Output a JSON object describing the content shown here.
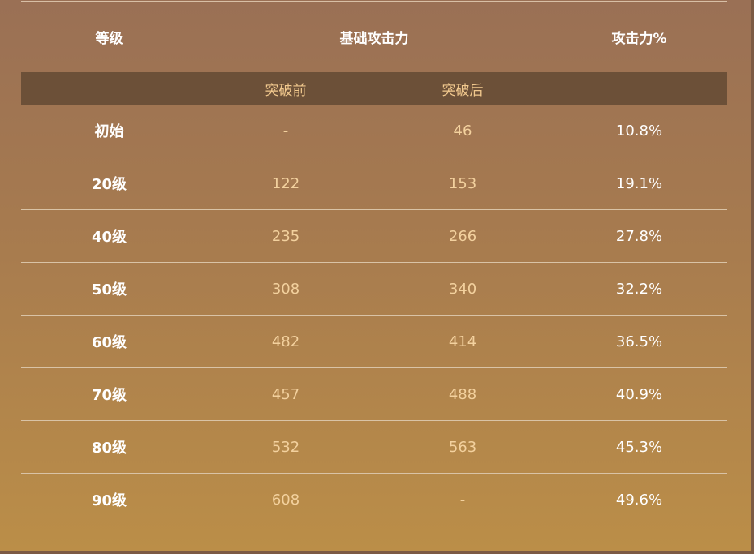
{
  "header": {
    "level": "等级",
    "base_attack": "基础攻击力",
    "attack_pct": "攻击力%"
  },
  "subheader": {
    "before": "突破前",
    "after": "突破后"
  },
  "rows": [
    {
      "level": "初始",
      "before": "-",
      "after": "46",
      "pct": "10.8%"
    },
    {
      "level": "20级",
      "before": "122",
      "after": "153",
      "pct": "19.1%"
    },
    {
      "level": "40级",
      "before": "235",
      "after": "266",
      "pct": "27.8%"
    },
    {
      "level": "50级",
      "before": "308",
      "after": "340",
      "pct": "32.2%"
    },
    {
      "level": "60级",
      "before": "482",
      "after": "414",
      "pct": "36.5%"
    },
    {
      "level": "70级",
      "before": "457",
      "after": "488",
      "pct": "40.9%"
    },
    {
      "level": "80级",
      "before": "532",
      "after": "563",
      "pct": "45.3%"
    },
    {
      "level": "90级",
      "before": "608",
      "after": "-",
      "pct": "49.6%"
    }
  ],
  "colors": {
    "background_top": "#9a7055",
    "background_bottom": "#bb8e48",
    "subheader_band": "#6c5038",
    "value_text": "#f3d19e",
    "label_text": "#ffffff"
  }
}
